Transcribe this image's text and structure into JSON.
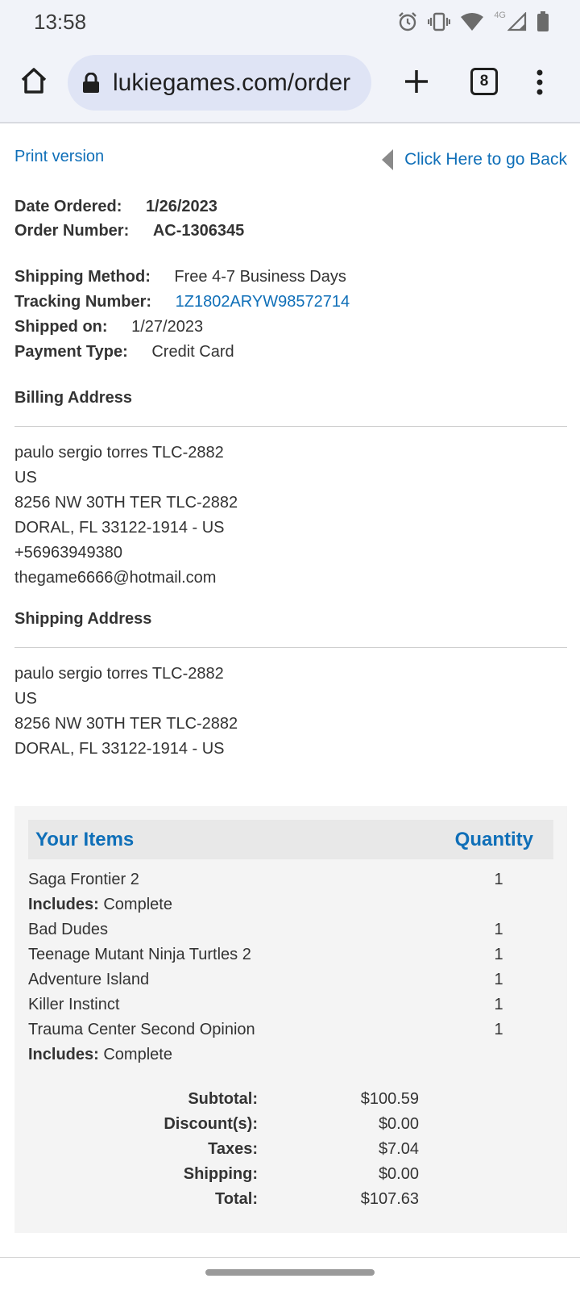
{
  "status_bar": {
    "time": "13:58",
    "network_label": "4G",
    "icons": [
      "alarm-icon",
      "vibrate-icon",
      "wifi-icon",
      "signal-icon",
      "battery-icon"
    ]
  },
  "browser": {
    "url": "lukiegames.com/order",
    "tab_count": "8",
    "icons": [
      "home-icon",
      "lock-icon",
      "plus-icon",
      "more-vert-icon"
    ]
  },
  "page": {
    "print_link": "Print version",
    "back_link": "Click Here to go Back",
    "order": {
      "date_label": "Date Ordered:",
      "date_value": "1/26/2023",
      "number_label": "Order Number:",
      "number_value": "AC-1306345",
      "shipping_method_label": "Shipping Method:",
      "shipping_method_value": "Free 4-7 Business Days",
      "tracking_label": "Tracking Number:",
      "tracking_value": "1Z1802ARYW98572714",
      "shipped_label": "Shipped on:",
      "shipped_value": "1/27/2023",
      "payment_label": "Payment Type:",
      "payment_value": "Credit Card"
    },
    "billing": {
      "title": "Billing Address",
      "lines": [
        "paulo sergio torres TLC-2882",
        "US",
        "8256 NW 30TH TER TLC-2882",
        "DORAL, FL 33122-1914 - US",
        "+56963949380",
        "thegame6666@hotmail.com"
      ]
    },
    "shipping": {
      "title": "Shipping Address",
      "lines": [
        "paulo sergio torres TLC-2882",
        "US",
        "8256 NW 30TH TER TLC-2882",
        "DORAL, FL 33122-1914 - US"
      ]
    },
    "items": {
      "header_items": "Your Items",
      "header_quantity": "Quantity",
      "includes_label": "Includes:",
      "rows": [
        {
          "name": "Saga Frontier 2",
          "qty": "1",
          "includes": "Complete"
        },
        {
          "name": "Bad Dudes",
          "qty": "1"
        },
        {
          "name": "Teenage Mutant Ninja Turtles 2",
          "qty": "1"
        },
        {
          "name": "Adventure Island",
          "qty": "1"
        },
        {
          "name": "Killer Instinct",
          "qty": "1"
        },
        {
          "name": "Trauma Center Second Opinion",
          "qty": "1",
          "includes": "Complete"
        }
      ]
    },
    "totals": {
      "subtotal_label": "Subtotal:",
      "subtotal_value": "$100.59",
      "discount_label": "Discount(s):",
      "discount_value": "$0.00",
      "taxes_label": "Taxes:",
      "taxes_value": "$7.04",
      "shipping_label": "Shipping:",
      "shipping_value": "$0.00",
      "total_label": "Total:",
      "total_value": "$107.63"
    }
  }
}
